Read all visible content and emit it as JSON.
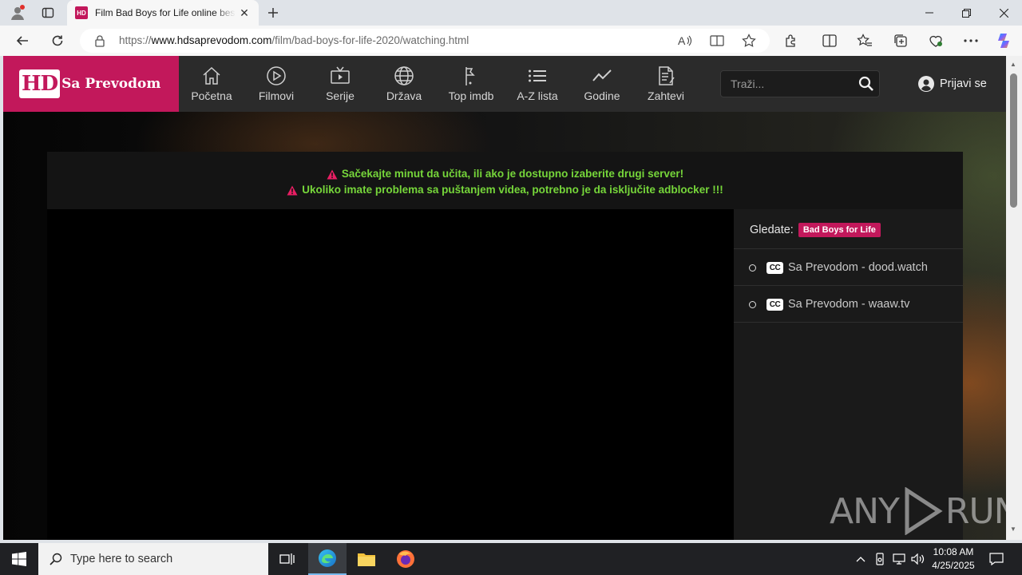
{
  "browser": {
    "tab_title": "Film Bad Boys for Life online besplatno sa prevodom",
    "tab_favicon_text": "HD",
    "url_prefix": "https://",
    "url_domain": "www.hdsaprevodom.com",
    "url_path": "/film/bad-boys-for-life-2020/watching.html"
  },
  "site": {
    "logo_badge": "HD",
    "logo_text": "Sa Prevodom",
    "menu": [
      {
        "label": "Početna",
        "icon": "home-icon"
      },
      {
        "label": "Filmovi",
        "icon": "play-circle-icon"
      },
      {
        "label": "Serije",
        "icon": "tv-icon"
      },
      {
        "label": "Država",
        "icon": "globe-icon"
      },
      {
        "label": "Top imdb",
        "icon": "flag-icon"
      },
      {
        "label": "A-Z lista",
        "icon": "list-icon"
      },
      {
        "label": "Godine",
        "icon": "trend-icon"
      },
      {
        "label": "Zahtevi",
        "icon": "request-doc-icon"
      }
    ],
    "search_placeholder": "Traži...",
    "login_label": "Prijavi se"
  },
  "notice": {
    "line1": "Sačekajte minut da učita, ili ako je dostupno izaberite drugi server!",
    "line2": "Ukoliko imate problema sa puštanjem videa, potrebno je da isključite adblocker !!!"
  },
  "servers": {
    "watching_label": "Gledate:",
    "movie_title": "Bad Boys for Life",
    "cc_label": "CC",
    "items": [
      {
        "label": "Sa Prevodom - dood.watch"
      },
      {
        "label": "Sa Prevodom - waaw.tv"
      }
    ]
  },
  "watermark": {
    "left": "ANY",
    "right": "RUN"
  },
  "taskbar": {
    "search_placeholder": "Type here to search",
    "time": "10:08 AM",
    "date": "4/25/2025"
  },
  "colors": {
    "brand": "#c2185b",
    "notice_green": "#76d63a",
    "header_bg": "#2b2b2b"
  }
}
